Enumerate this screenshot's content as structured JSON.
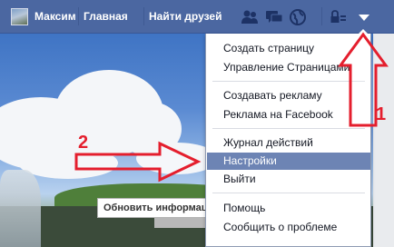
{
  "topbar": {
    "user_name": "Максим",
    "home_label": "Главная",
    "find_friends_label": "Найти друзей",
    "icons": [
      "friend-requests-icon",
      "messages-icon",
      "notifications-icon",
      "privacy-shortcuts-icon",
      "account-menu-icon"
    ]
  },
  "cover": {
    "tooltip_text": "Обновить информацию"
  },
  "menu": {
    "items": [
      {
        "label": "Создать страницу"
      },
      {
        "label": "Управление Страницами"
      },
      {
        "label": "Создавать рекламу"
      },
      {
        "label": "Реклама на Facebook"
      },
      {
        "label": "Журнал действий"
      },
      {
        "label": "Настройки"
      },
      {
        "label": "Выйти"
      },
      {
        "label": "Помощь"
      },
      {
        "label": "Сообщить о проблеме"
      }
    ],
    "active_item": "Настройки"
  },
  "annotations": {
    "step1": "1",
    "step2": "2",
    "color": "#e41e2d"
  },
  "colors": {
    "facebook_blue": "#4b67a1",
    "menu_highlight": "#6d84b4"
  }
}
